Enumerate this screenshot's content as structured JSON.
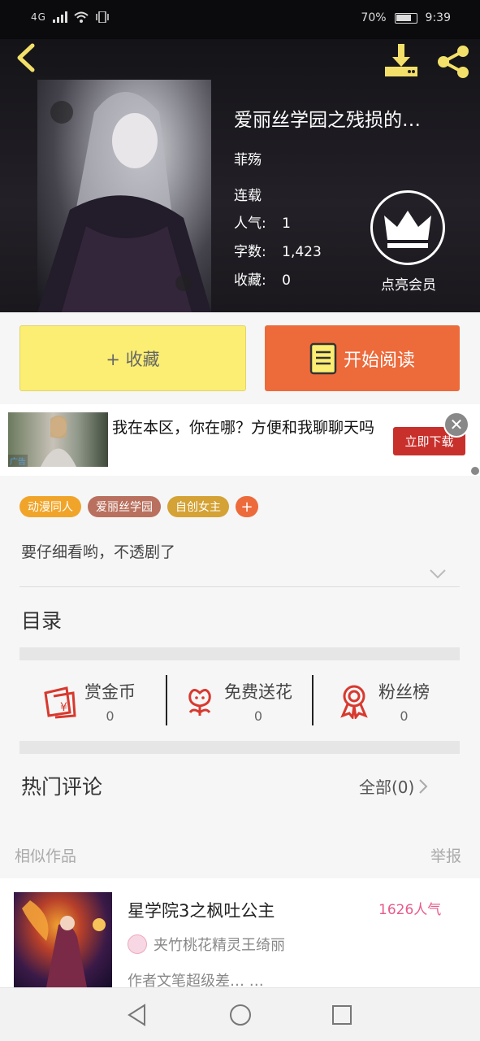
{
  "status_bar": {
    "signal": "4G",
    "battery": "70%",
    "time": "9:39"
  },
  "book": {
    "title": "爱丽丝学园之残损的…",
    "author": "菲殇",
    "status": "连载",
    "popularity_label": "人气:",
    "popularity": "1",
    "words_label": "字数:",
    "words": "1,423",
    "favorites_label": "收藏:",
    "favorites": "0",
    "vip_label": "点亮会员"
  },
  "buttons": {
    "collect": "+ 收藏",
    "read": "开始阅读"
  },
  "ad": {
    "tag": "广告",
    "text": "我在本区，你在哪？方便和我聊聊天吗",
    "cta": "立即下载",
    "close": "✕"
  },
  "tags": [
    {
      "label": "动漫同人",
      "color": "#f0a52a"
    },
    {
      "label": "爱丽丝学园",
      "color": "#b9705e"
    },
    {
      "label": "自创女主",
      "color": "#d4a235"
    }
  ],
  "tag_add": "+",
  "intro": "要仔细看哟，不透剧了",
  "toc_label": "目录",
  "actions": [
    {
      "label": "赏金币",
      "count": "0"
    },
    {
      "label": "免费送花",
      "count": "0"
    },
    {
      "label": "粉丝榜",
      "count": "0"
    }
  ],
  "comments": {
    "title": "热门评论",
    "all_label": "全部(0)"
  },
  "similar": {
    "title": "相似作品",
    "report": "举报",
    "items": [
      {
        "title": "星学院3之枫吐公主",
        "popularity": "1626人气",
        "author": "夹竹桃花精灵王绮丽",
        "desc": "作者文笔超级差…  …"
      }
    ]
  },
  "colors": {
    "accent": "#ed6a3b",
    "collect_bg": "#fbee73",
    "hero_bg": "#1a181d",
    "icon_red": "#d8392f"
  }
}
